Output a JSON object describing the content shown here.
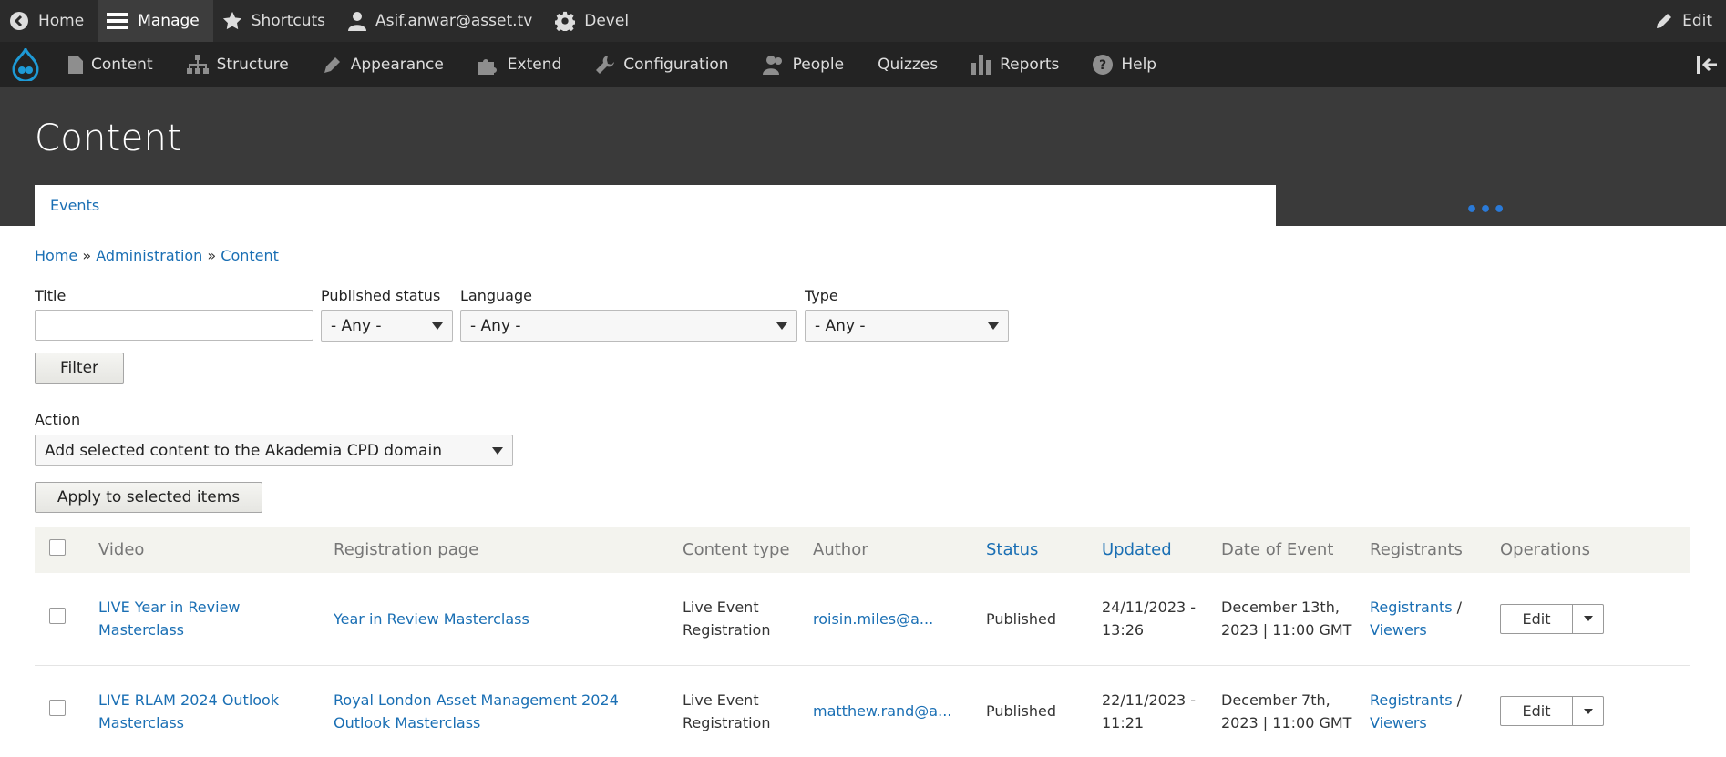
{
  "toolbar": {
    "home": "Home",
    "manage": "Manage",
    "shortcuts": "Shortcuts",
    "user": "Asif.anwar@asset.tv",
    "devel": "Devel",
    "edit": "Edit"
  },
  "tray": {
    "items": [
      "Content",
      "Structure",
      "Appearance",
      "Extend",
      "Configuration",
      "People",
      "Quizzes",
      "Reports",
      "Help"
    ]
  },
  "header": {
    "title": "Content",
    "tab": "Events",
    "more": "•••"
  },
  "breadcrumb": {
    "home": "Home",
    "sep": "»",
    "administration": "Administration",
    "content": "Content"
  },
  "filters": {
    "title_label": "Title",
    "title_value": "",
    "status_label": "Published status",
    "status_value": "- Any -",
    "language_label": "Language",
    "language_value": "- Any -",
    "type_label": "Type",
    "type_value": "- Any -",
    "filter_button": "Filter"
  },
  "action": {
    "label": "Action",
    "value": "Add selected content to the Akademia CPD domain",
    "apply_button": "Apply to selected items"
  },
  "table": {
    "headers": [
      "Video",
      "Registration page",
      "Content type",
      "Author",
      "Status",
      "Updated",
      "Date of Event",
      "Registrants",
      "Operations"
    ],
    "rows": [
      {
        "video": "LIVE Year in Review Masterclass",
        "registration": "Year in Review Masterclass",
        "type": "Live Event Registration",
        "author": "roisin.miles@a...",
        "status": "Published",
        "updated": "24/11/2023 - 13:26",
        "date": "December 13th, 2023 | 11:00 GMT",
        "registrants": "Registrants",
        "sep": " / ",
        "viewers": "Viewers",
        "edit": "Edit"
      },
      {
        "video": "LIVE RLAM 2024 Outlook Masterclass",
        "registration": "Royal London Asset Management 2024 Outlook Masterclass",
        "type": "Live Event Registration",
        "author": "matthew.rand@a...",
        "status": "Published",
        "updated": "22/11/2023 - 11:21",
        "date": "December 7th, 2023 | 11:00 GMT",
        "registrants": "Registrants",
        "sep": " / ",
        "viewers": "Viewers",
        "edit": "Edit"
      }
    ]
  }
}
